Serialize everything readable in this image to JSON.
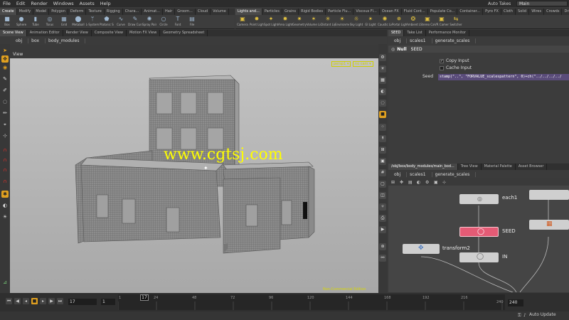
{
  "menu": [
    "File",
    "Edit",
    "Render",
    "Windows",
    "Assets",
    "Help"
  ],
  "header": {
    "auto_takes": "Auto Takes",
    "desktop": "Main"
  },
  "shelf_tabs_left": [
    "Create",
    "Modify",
    "Model",
    "Polygon",
    "Deform",
    "Texture",
    "Rigging",
    "Chara...",
    "Animat...",
    "Hair",
    "Groom...",
    "Cloud",
    "Volume"
  ],
  "shelf_tabs_right": [
    "Lights and...",
    "Particles",
    "Grains",
    "Rigid Bodies",
    "Particle Flu...",
    "Viscous Fl...",
    "Ocean FX",
    "Fluid Cont...",
    "Populate Co...",
    "Container...",
    "Pyro FX",
    "Cloth",
    "Solid",
    "Wires",
    "Crowds",
    "Drive Simu..."
  ],
  "shelf_tools_left": [
    {
      "icon": "box-icon",
      "glyph": "■",
      "label": "Box"
    },
    {
      "icon": "sphere-icon",
      "glyph": "●",
      "label": "Sphere"
    },
    {
      "icon": "tube-icon",
      "glyph": "▮",
      "label": "Tube"
    },
    {
      "icon": "torus-icon",
      "glyph": "◎",
      "label": "Torus"
    },
    {
      "icon": "grid-icon",
      "glyph": "▦",
      "label": "Grid"
    },
    {
      "icon": "metaball-icon",
      "glyph": "⬤",
      "label": "Metaball"
    },
    {
      "icon": "lsystem-icon",
      "glyph": "ᛘ",
      "label": "L-System"
    },
    {
      "icon": "platonic-icon",
      "glyph": "⬟",
      "label": "Platonic Sol..."
    },
    {
      "icon": "curve-icon",
      "glyph": "∿",
      "label": "Curve"
    },
    {
      "icon": "draw-curve-icon",
      "glyph": "✎",
      "label": "Draw Curve"
    },
    {
      "icon": "spray-paint-icon",
      "glyph": "✺",
      "label": "Spray Paint"
    },
    {
      "icon": "circle-icon",
      "glyph": "○",
      "label": "Circle"
    },
    {
      "icon": "font-icon",
      "glyph": "T",
      "label": "Font"
    },
    {
      "icon": "file-icon",
      "glyph": "▤",
      "label": "File"
    }
  ],
  "shelf_tools_right": [
    {
      "icon": "camera-icon",
      "glyph": "▣",
      "label": "Camera"
    },
    {
      "icon": "point-light-icon",
      "glyph": "✸",
      "label": "Point Light"
    },
    {
      "icon": "spot-light-icon",
      "glyph": "✦",
      "label": "Spot Light"
    },
    {
      "icon": "area-light-icon",
      "glyph": "✹",
      "label": "Area Light"
    },
    {
      "icon": "geometry-light-icon",
      "glyph": "✷",
      "label": "Geometry L..."
    },
    {
      "icon": "volume-light-icon",
      "glyph": "✶",
      "label": "Volume Light"
    },
    {
      "icon": "distant-light-icon",
      "glyph": "✳",
      "label": "Distant Light"
    },
    {
      "icon": "environment-light-icon",
      "glyph": "☀",
      "label": "Environmen..."
    },
    {
      "icon": "sky-light-icon",
      "glyph": "☼",
      "label": "Sky Light"
    },
    {
      "icon": "gi-light-icon",
      "glyph": "✴",
      "label": "GI Light"
    },
    {
      "icon": "caustic-light-icon",
      "glyph": "✺",
      "label": "Caustic Light"
    },
    {
      "icon": "portal-light-icon",
      "glyph": "✵",
      "label": "Portal Light"
    },
    {
      "icon": "ambient-light-icon",
      "glyph": "❂",
      "label": "Ambient Lig..."
    },
    {
      "icon": "stereo-camera-icon",
      "glyph": "▣",
      "label": "Stereo Cam..."
    },
    {
      "icon": "vr-camera-icon",
      "glyph": "▣",
      "label": "VR Camera"
    },
    {
      "icon": "switcher-icon",
      "glyph": "⇆",
      "label": "Switcher"
    }
  ],
  "pane_tabs_left": [
    "Scene View",
    "Animation Editor",
    "Render View",
    "Composite View",
    "Motion FX View",
    "Geometry Spreadsheet"
  ],
  "pane_tabs_right": [
    "SEED",
    "Take List",
    "Performance Monitor"
  ],
  "viewport": {
    "path": [
      "obj",
      "box",
      "body_modules"
    ],
    "title": "View",
    "persp": "persp1 ▾",
    "cam": "no cam ▾",
    "non_commercial": "Non-Commercial Edition",
    "watermark": "www.cgtsj.com"
  },
  "params": {
    "path": [
      "obj",
      "scales1",
      "generate_scales"
    ],
    "node_type": "Null",
    "node_name": "SEED",
    "copy_input": "Copy Input",
    "cache_input": "Cache Input",
    "seed_label": "Seed",
    "seed_value": "stamp(\"..\", \"FORVALUE_scalespattern\", 0)+ch(\"../../../../"
  },
  "network": {
    "tabs": [
      "/obj/box/body_modules/main_bod...",
      "Tree View",
      "Material Palette",
      "Asset Browser"
    ],
    "path": [
      "obj",
      "scales1",
      "generate_scales"
    ],
    "nodes": {
      "each1": "each1",
      "seed": "SEED",
      "transform2": "transform2",
      "in": "IN"
    }
  },
  "timeline": {
    "frame": "17",
    "step": "1",
    "current": "17",
    "ticks": [
      "1",
      "24",
      "48",
      "72",
      "96",
      "120",
      "144",
      "168",
      "192",
      "216"
    ],
    "end": "240",
    "end_hint": "240",
    "auto_update": "Auto Update"
  },
  "colors": {
    "accent": "#e0a020",
    "seed_node": "#e45b75",
    "watermark": "#ffff00"
  }
}
